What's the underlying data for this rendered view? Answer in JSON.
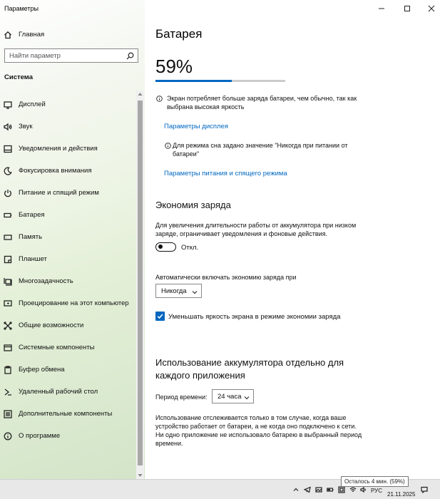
{
  "window": {
    "title": "Параметры"
  },
  "sidebar": {
    "home_label": "Главная",
    "search_placeholder": "Найти параметр",
    "section_label": "Система",
    "items": [
      {
        "label": "Дисплей",
        "icon": "display-icon"
      },
      {
        "label": "Звук",
        "icon": "speaker-icon"
      },
      {
        "label": "Уведомления и действия",
        "icon": "notification-icon"
      },
      {
        "label": "Фокусировка внимания",
        "icon": "moon-icon"
      },
      {
        "label": "Питание и спящий режим",
        "icon": "power-icon"
      },
      {
        "label": "Батарея",
        "icon": "battery-icon"
      },
      {
        "label": "Память",
        "icon": "storage-icon"
      },
      {
        "label": "Планшет",
        "icon": "tablet-icon"
      },
      {
        "label": "Многозадачность",
        "icon": "multitasking-icon"
      },
      {
        "label": "Проецирование на этот компьютер",
        "icon": "projecting-icon"
      },
      {
        "label": "Общие возможности",
        "icon": "shared-experiences-icon"
      },
      {
        "label": "Системные компоненты",
        "icon": "system-components-icon"
      },
      {
        "label": "Буфер обмена",
        "icon": "clipboard-icon"
      },
      {
        "label": "Удаленный рабочий стол",
        "icon": "remote-desktop-icon"
      },
      {
        "label": "Дополнительные компоненты",
        "icon": "optional-features-icon"
      },
      {
        "label": "О программе",
        "icon": "info-icon"
      }
    ]
  },
  "main": {
    "title": "Батарея",
    "battery_percent_text": "59%",
    "battery_level": 0.59,
    "info1": "Экран потребляет больше заряда батареи, чем обычно, так как выбрана высокая яркость",
    "link1": "Параметры дисплея",
    "info2": "Для режима сна задано значение \"Никогда при питании от батареи\"",
    "link2": "Параметры питания и спящего режима",
    "saver": {
      "heading": "Экономия заряда",
      "description": "Для увеличения длительности работы от аккумулятора при низком заряде, ограничивает уведомления и фоновые действия.",
      "toggle_label": "Откл.",
      "auto_label": "Автоматически включать экономию заряда при",
      "auto_value": "Никогда",
      "checkbox_label": "Уменьшать яркость экрана в режиме экономии заряда"
    },
    "usage": {
      "heading": "Использование аккумулятора отдельно для каждого приложения",
      "period_label": "Период времени:",
      "period_value": "24 часа",
      "description": "Использование отслеживается только в том случае, когда ваше устройство работает от батареи, а не когда оно подключено к сети. Ни одно приложение не использовало батарею в выбранный период времени."
    }
  },
  "taskbar": {
    "language": "РУС",
    "date": "21.11.2025",
    "tooltip": "Осталось 4 мин. (59%)"
  },
  "colors": {
    "accent": "#0067c0"
  }
}
